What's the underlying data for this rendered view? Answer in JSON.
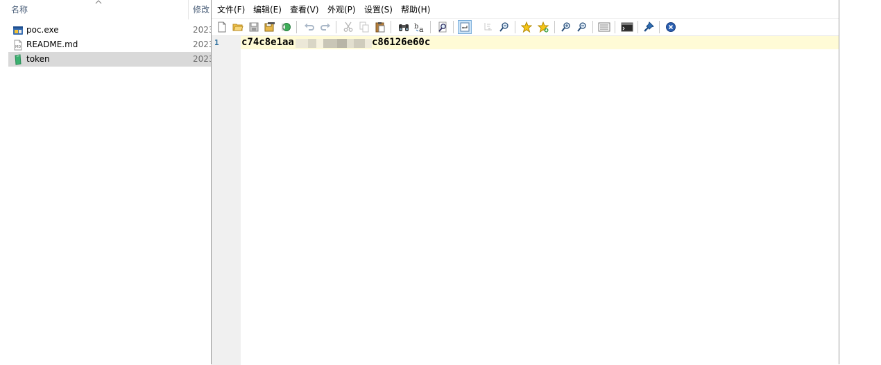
{
  "explorer": {
    "columns": {
      "name": "名称",
      "date": "修改"
    },
    "files": [
      {
        "name": "poc.exe",
        "date": "2023",
        "icon": "exe-icon"
      },
      {
        "name": "README.md",
        "date": "2023",
        "icon": "md-file-icon"
      },
      {
        "name": "token",
        "date": "2023",
        "icon": "token-file-icon",
        "selected": true
      }
    ]
  },
  "notepad": {
    "menu": [
      "文件(F)",
      "编辑(E)",
      "查看(V)",
      "外观(P)",
      "设置(S)",
      "帮助(H)"
    ],
    "toolbar": [
      "new",
      "open",
      "save",
      "save-all",
      "revert",
      "undo",
      "redo",
      "cut",
      "copy",
      "paste",
      "find",
      "replace",
      "find-in-files",
      "word-wrap",
      "show-whitespace",
      "zoom-find",
      "bookmark",
      "bookmark-add",
      "zoom-in",
      "zoom-out",
      "view-list",
      "terminal",
      "pin",
      "close"
    ],
    "editor": {
      "line_number": "1",
      "text_start": "c74c8e1aa",
      "text_end": "c86126e60c"
    },
    "colors": {
      "current_line": "#fffbd6",
      "gutter": "#f0f0f0",
      "selection": "#d9d9d9"
    }
  }
}
